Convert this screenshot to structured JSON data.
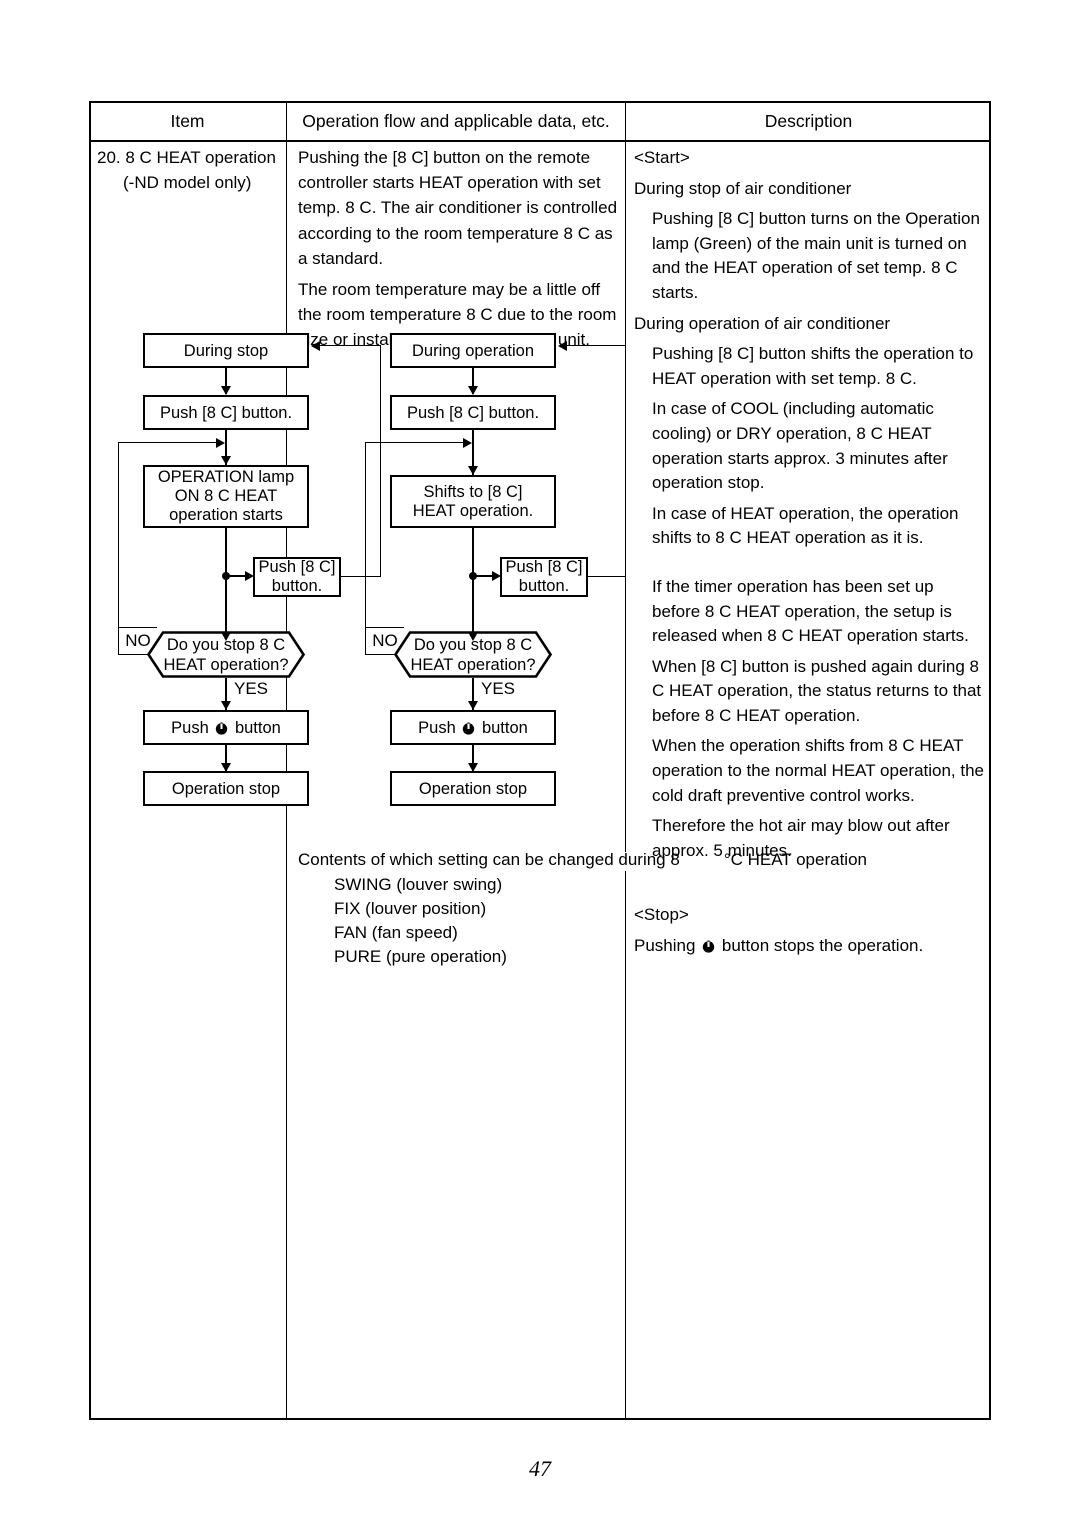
{
  "page": {
    "number": "47"
  },
  "table": {
    "headers": {
      "item": "Item",
      "flow": "Operation flow and applicable data, etc.",
      "description": "Description"
    }
  },
  "item": {
    "line1": "20.  8 C HEAT operation",
    "line2": "(-ND model only)"
  },
  "flow_text": {
    "para1": "Pushing the [8 C] button on the remote controller starts HEAT operation with set temp. 8 C. The air conditioner is controlled according to the room temperature 8 C as a standard.",
    "para2": "The room temperature may be a little off the room temperature 8 C due to the room size or installation condition of the unit."
  },
  "description": {
    "start_heading": "<Start>",
    "stop_state_heading": "During stop of air conditioner",
    "stop_state_body": "Pushing [8 C] button turns on the Operation lamp (Green) of the main unit is turned on and the HEAT operation of set temp. 8 C starts.",
    "operation_state_heading": "During operation of air conditioner",
    "operation_state_body_1": "Pushing [8 C] button shifts the operation to HEAT operation with set temp. 8 C.",
    "operation_state_body_2": "In case of COOL (including automatic cooling) or DRY operation, 8 C HEAT operation starts approx. 3 minutes after operation stop.",
    "operation_state_body_3": "In case of HEAT operation, the operation shifts to 8 C HEAT operation as it is.",
    "note_1": "If the timer operation has been set up before 8 C HEAT operation, the setup is released when 8 C HEAT operation starts.",
    "note_2": "When [8 C] button is pushed again during 8 C HEAT operation, the status returns to that before 8 C HEAT operation.",
    "note_3": "When the operation shifts from 8 C HEAT operation to the normal HEAT operation, the cold draft preventive control works.",
    "note_4": "Therefore the hot air may blow out after approx. 5 minutes.",
    "stop_heading": "<Stop>",
    "stop_body_before": "Pushing ",
    "stop_body_after": " button stops the operation.",
    "power_icon": "power-icon"
  },
  "flowchart": {
    "left": {
      "title": "During stop",
      "step_push": "Push [8 C] button.",
      "step_lamp_l1": "OPERATION lamp",
      "step_lamp_l2": "ON 8 C HEAT",
      "step_lamp_l3": "operation starts",
      "branch_push_l1": "Push [8 C]",
      "branch_push_l2": "button.",
      "decision_l1": "Do you stop 8 C",
      "decision_l2": "HEAT operation?",
      "no_label": "NO",
      "yes_label": "YES",
      "step_power_before": "Push ",
      "step_power_after": " button",
      "step_stop": "Operation stop"
    },
    "right": {
      "title": "During operation",
      "step_push": "Push [8 C] button.",
      "step_shift_l1": "Shifts to [8 C]",
      "step_shift_l2": "HEAT operation.",
      "branch_push_l1": "Push [8 C]",
      "branch_push_l2": "button.",
      "decision_l1": "Do you stop 8 C",
      "decision_l2": "HEAT operation?",
      "no_label": "NO",
      "yes_label": "YES",
      "step_power_before": "Push ",
      "step_power_after": " button",
      "step_stop": "Operation stop"
    }
  },
  "contents": {
    "heading_part1": "Contents of which setting can be changed during 8",
    "heading_part2": "°C HEAT operation",
    "items": [
      "SWING (louver swing)",
      "FIX (louver position)",
      "FAN (fan speed)",
      "PURE (pure operation)"
    ]
  }
}
